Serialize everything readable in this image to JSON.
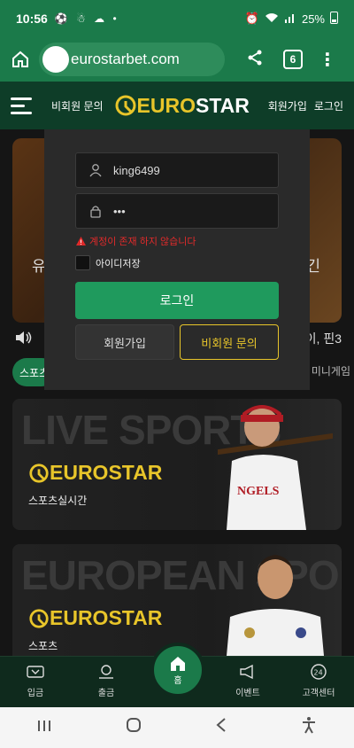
{
  "status_bar": {
    "time": "10:56",
    "left_icons": "⚽ ☃ ☁ •",
    "battery": "25%"
  },
  "browser": {
    "url": "eurostarbet.com",
    "tab_count": "6"
  },
  "header": {
    "inquiry_link": "비회원 문의",
    "logo_euro": "EURO",
    "logo_star": "STAR",
    "signup_link": "회원가입",
    "login_link": "로그인"
  },
  "background": {
    "banner_left_text": "유",
    "banner_right_text": "긴",
    "notice_text": "이, 핀3",
    "tab_sports": "스포츠",
    "tab_mini": "미니게임",
    "cards": [
      {
        "big_text": "LIVE SPORTS",
        "logo_euro": "EURO",
        "logo_star": "STAR",
        "subtitle": "스포츠실시간"
      },
      {
        "big_text": "EUROPEAN SPORTS",
        "logo_euro": "EURO",
        "logo_star": "STAR",
        "subtitle": "스포츠"
      }
    ]
  },
  "login_modal": {
    "username_value": "king6499",
    "password_value": "•••",
    "error_message": "계정이 존재 하지 않습니다",
    "remember_label": "아이디저장",
    "login_button": "로그인",
    "signup_button": "회원가입",
    "inquiry_button": "비회원 문의"
  },
  "bottom_nav": {
    "deposit": "입금",
    "withdraw": "출금",
    "home": "홈",
    "events": "이벤트",
    "support": "고객센터"
  },
  "colors": {
    "primary_green": "#1b7a4a",
    "brand_yellow": "#e8c52a",
    "error_red": "#e02a2a"
  }
}
